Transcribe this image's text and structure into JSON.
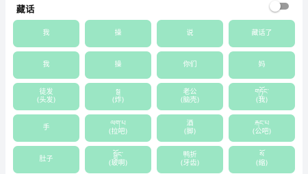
{
  "title": "藏话",
  "toggle": {
    "state": "off"
  },
  "accent_color": "#9be6c4",
  "tiles": [
    {
      "main": "我",
      "sub": ""
    },
    {
      "main": "操",
      "sub": ""
    },
    {
      "main": "说",
      "sub": ""
    },
    {
      "main": "藏话了",
      "sub": ""
    },
    {
      "main": "我",
      "sub": ""
    },
    {
      "main": "操",
      "sub": ""
    },
    {
      "main": "你们",
      "sub": ""
    },
    {
      "main": "妈",
      "sub": ""
    },
    {
      "main": "徒发",
      "sub": "(头发)"
    },
    {
      "main": "སྒ",
      "sub": "(炸)"
    },
    {
      "main": "老公",
      "sub": "(脑壳)"
    },
    {
      "main": "གཏོང་",
      "sub": "(我)"
    },
    {
      "main": "手",
      "sub": ""
    },
    {
      "main": "ལག་པ",
      "sub": "(拉吧)"
    },
    {
      "main": "酒",
      "sub": "(脚)"
    },
    {
      "main": "རྐང་པ",
      "sub": "(公吧)"
    },
    {
      "main": "肚子",
      "sub": ""
    },
    {
      "main": "སྒྲོང་",
      "sub": "(玻啊)"
    },
    {
      "main": "鸭折",
      "sub": "(牙齿)"
    },
    {
      "main": "སོ",
      "sub": "(缩)"
    }
  ]
}
